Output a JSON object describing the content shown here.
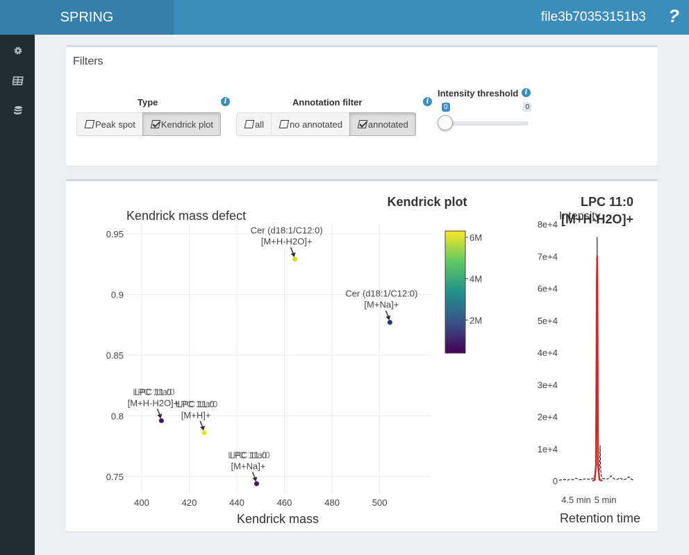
{
  "header": {
    "app_name": "SPRING",
    "file_name": "file3b70353151b3",
    "help_label": "?"
  },
  "sidebar": {
    "items": [
      {
        "icon": "gear-icon"
      },
      {
        "icon": "table-icon"
      },
      {
        "icon": "database-icon"
      }
    ]
  },
  "filters": {
    "title": "Filters",
    "type": {
      "label": "Type",
      "info": "i",
      "options": [
        "Peak spot",
        "Kendrick plot"
      ],
      "selected": "Kendrick plot"
    },
    "annotation": {
      "label": "Annotation filter",
      "info": "i",
      "options": [
        "all",
        "no annotated",
        "annotated"
      ],
      "selected": "annotated"
    },
    "intensity": {
      "label": "Intensity threshold",
      "info": "i",
      "value": "0",
      "max": "0",
      "fraction": 0
    }
  },
  "colors": {
    "header": "#3c8dbc",
    "logo_bg": "#367fa9",
    "sidebar": "#222d32",
    "chromatogram": "#d62728"
  },
  "chart_data": [
    {
      "type": "scatter",
      "title": "Kendrick plot",
      "xlabel": "Kendrick mass",
      "ylabel": "Kendrick mass defect",
      "xlim": [
        393,
        522
      ],
      "ylim": [
        0.735,
        0.958
      ],
      "xticks": [
        "400",
        "420",
        "440",
        "460",
        "480",
        "500"
      ],
      "yticks": [
        "0.75",
        "0.8",
        "0.85",
        "0.9",
        "0.95"
      ],
      "colorbar": {
        "ticks": [
          "2M",
          "4M",
          "6M"
        ],
        "colors": [
          "#440154",
          "#3b528b",
          "#21918c",
          "#5ec962",
          "#fde725"
        ]
      },
      "points": [
        {
          "x": 464.4,
          "y": 0.929,
          "color": "#c8e020",
          "label": [
            "Cer (d18:1/C12:0)",
            "[M+H-H2O]+"
          ]
        },
        {
          "x": 504.3,
          "y": 0.877,
          "color": "#2a3a70",
          "label": [
            "Cer (d18:1/C12:0)",
            "[M+Na]+"
          ]
        },
        {
          "x": 408.3,
          "y": 0.796,
          "color": "#3b1c5c",
          "label": [
            "LPC 11:0",
            "[M+H-H2O]+"
          ],
          "label_overlap": "LPC 11a:0"
        },
        {
          "x": 426.3,
          "y": 0.786,
          "color": "#e6e419",
          "label": [
            "LPC 11:0",
            "[M+H]+"
          ],
          "label_overlap": "LPC 11a:0"
        },
        {
          "x": 448.3,
          "y": 0.744,
          "color": "#3b1c5c",
          "label": [
            "LPC 11:0",
            "[M+Na]+"
          ],
          "label_overlap": "LPC 11a:0"
        }
      ]
    },
    {
      "type": "line",
      "title": "LPC 11:0",
      "subtitle": "[M+H-H2O]+",
      "xlabel": "Retention time",
      "ylabel": "Intensity",
      "xticks": [
        "4.5 min",
        "5 min"
      ],
      "yticks": [
        "0",
        "1e+4",
        "2e+4",
        "3e+4",
        "4e+4",
        "5e+4",
        "6e+4",
        "7e+4",
        "8e+4"
      ],
      "ylim": [
        0,
        80000
      ],
      "xlim": [
        4.21,
        5.48
      ],
      "series": [
        {
          "style": "dashed",
          "x": [
            4.21,
            4.25,
            4.3,
            4.35,
            4.4,
            4.45,
            4.5,
            4.55,
            4.6,
            4.65,
            4.7,
            4.75,
            4.8,
            4.82,
            4.84,
            4.86,
            4.87,
            4.88,
            4.89,
            4.9,
            4.91,
            4.92,
            4.93,
            4.95,
            5.0,
            5.05,
            5.1,
            5.15,
            5.2,
            5.25,
            5.3,
            5.35,
            5.4,
            5.45,
            5.48
          ],
          "y": [
            200,
            300,
            400,
            200,
            500,
            300,
            800,
            400,
            300,
            600,
            500,
            400,
            900,
            1800,
            6000,
            76000,
            48000,
            5000,
            3000,
            3500,
            11000,
            4000,
            1500,
            800,
            500,
            700,
            1500,
            600,
            400,
            900,
            300,
            500,
            1200,
            400,
            300
          ]
        },
        {
          "style": "solid",
          "x": [
            4.78,
            4.82,
            4.84,
            4.855,
            4.86,
            4.865,
            4.875,
            4.9,
            4.95
          ],
          "y": [
            0,
            300,
            5000,
            62000,
            70000,
            62000,
            5000,
            300,
            0
          ]
        }
      ]
    }
  ]
}
